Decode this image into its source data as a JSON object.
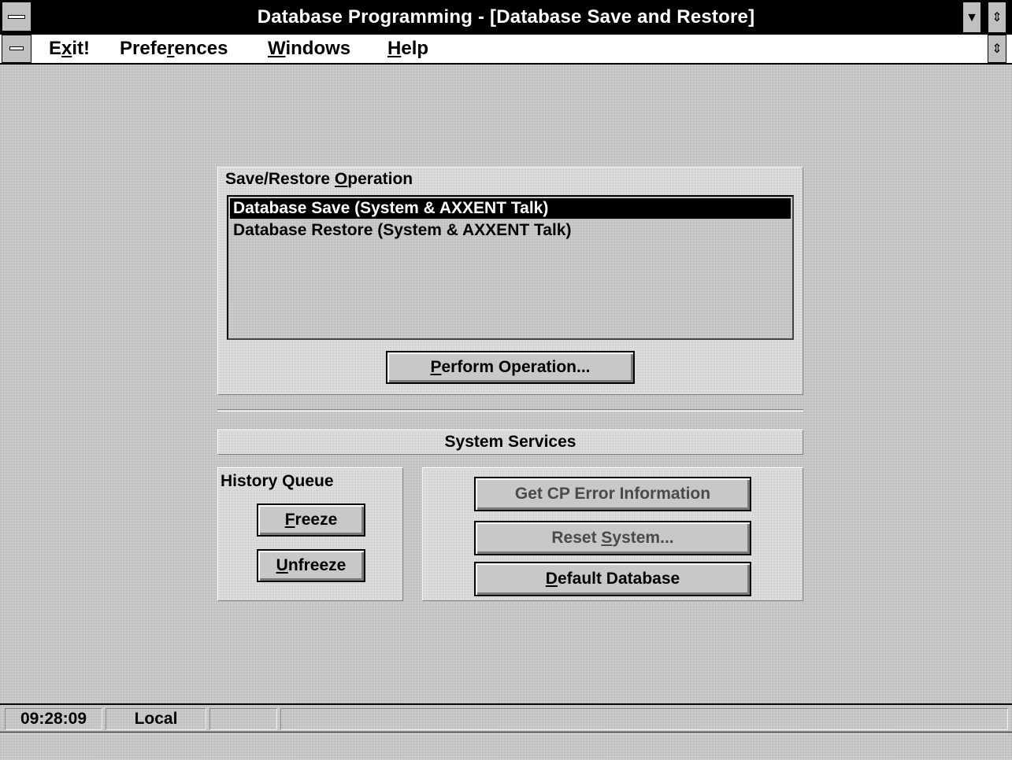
{
  "window": {
    "title": "Database Programming - [Database Save and Restore]"
  },
  "menu": {
    "exit_pre": "E",
    "exit_ul": "x",
    "exit_post": "it!",
    "pref_pre": "Prefe",
    "pref_ul": "r",
    "pref_post": "ences",
    "windows_ul": "W",
    "windows_post": "indows",
    "help_ul": "H",
    "help_post": "elp"
  },
  "save_restore": {
    "group_label_pre": "Save/Restore ",
    "group_label_ul": "O",
    "group_label_post": "peration",
    "items": [
      {
        "label": "Database Save (System & AXXENT Talk)",
        "selected": true
      },
      {
        "label": "Database Restore (System & AXXENT Talk)",
        "selected": false
      }
    ],
    "perform_ul": "P",
    "perform_post": "erform Operation..."
  },
  "system_services": {
    "header": "System Services",
    "history_queue_label": "History Queue",
    "freeze_ul": "F",
    "freeze_post": "reeze",
    "unfreeze_ul": "U",
    "unfreeze_post": "nfreeze",
    "get_cp_error": "Get CP Error Information",
    "reset_pre": "Reset ",
    "reset_ul": "S",
    "reset_post": "ystem...",
    "default_ul": "D",
    "default_post": "efault Database"
  },
  "status": {
    "time": "09:28:09",
    "mode": "Local"
  },
  "icons": {
    "system_menu": "system-menu-icon",
    "minimize": "minimize-arrow-icon",
    "restore": "restore-arrows-icon"
  }
}
